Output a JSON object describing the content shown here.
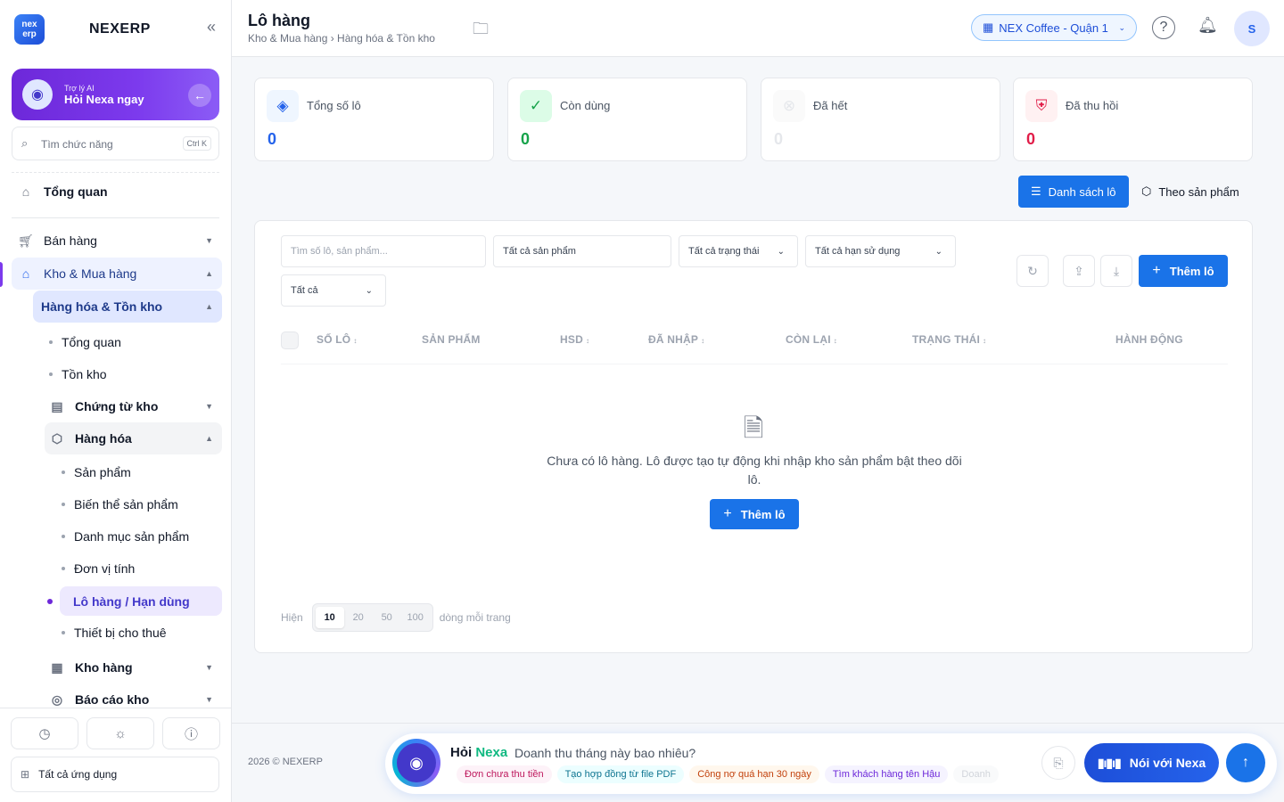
{
  "app": {
    "name": "NEXERP",
    "logo_text": "nex erp"
  },
  "ai_card": {
    "sub": "Trợ lý AI",
    "title": "Hỏi Nexa ngay"
  },
  "sidebar": {
    "search_placeholder": "Tìm chức năng",
    "search_shortcut": "Ctrl K",
    "items": {
      "overview": "Tổng quan",
      "sales": "Bán hàng",
      "inventory_purchase": "Kho & Mua hàng",
      "goods_stock": "Hàng hóa & Tồn kho",
      "sub_overview": "Tổng quan",
      "stock": "Tồn kho",
      "warehouse_docs": "Chứng từ kho",
      "goods": "Hàng hóa",
      "products": "Sản phẩm",
      "variants": "Biến thể sản phẩm",
      "categories": "Danh mục sản phẩm",
      "units": "Đơn vị tính",
      "lots": "Lô hàng / Hạn dùng",
      "rental": "Thiết bị cho thuê",
      "warehouses": "Kho hàng",
      "reports": "Báo cáo kho"
    },
    "all_apps": "Tất cả ứng dụng"
  },
  "header": {
    "title": "Lô hàng",
    "breadcrumb": "Kho & Mua hàng › Hàng hóa & Tồn kho",
    "store": "NEX Coffee - Quận 1",
    "avatar": "S"
  },
  "stats": [
    {
      "label": "Tổng số lô",
      "value": "0",
      "color": "#2563eb"
    },
    {
      "label": "Còn dùng",
      "value": "0",
      "color": "#16a34a"
    },
    {
      "label": "Đã hết",
      "value": "0",
      "color": "#e5e7eb"
    },
    {
      "label": "Đã thu hồi",
      "value": "0",
      "color": "#e11d48"
    }
  ],
  "tabs": {
    "list": "Danh sách lô",
    "by_product": "Theo sản phẩm"
  },
  "filters": {
    "search_placeholder": "Tìm số lô, sản phẩm...",
    "product": "Tất cả sản phẩm",
    "status": "Tất cả trạng thái",
    "expiry": "Tất cả hạn sử dụng",
    "all": "Tất cả"
  },
  "add_button": "Thêm lô",
  "table": {
    "columns": [
      "SỐ LÔ",
      "SẢN PHẨM",
      "HSD",
      "ĐÃ NHẬP",
      "CÒN LẠI",
      "TRẠNG THÁI",
      "HÀNH ĐỘNG"
    ]
  },
  "empty": {
    "text": "Chưa có lô hàng. Lô được tạo tự động khi nhập kho sản phẩm bật theo dõi lô.",
    "button": "Thêm lô"
  },
  "pager": {
    "prefix": "Hiện",
    "sizes": [
      "10",
      "20",
      "50",
      "100"
    ],
    "suffix": "dòng mỗi trang"
  },
  "footer": {
    "copyright": "2026 © NEXERP"
  },
  "nexa": {
    "title_a": "Hỏi",
    "title_b": "Nexa",
    "question": "Doanh thu tháng này bao nhiêu?",
    "chips": [
      "Đơn chưa thu tiền",
      "Tạo hợp đồng từ file PDF",
      "Công nợ quá hạn 30 ngày",
      "Tìm khách hàng tên Hậu",
      "Doanh"
    ],
    "talk": "Nói với Nexa"
  }
}
